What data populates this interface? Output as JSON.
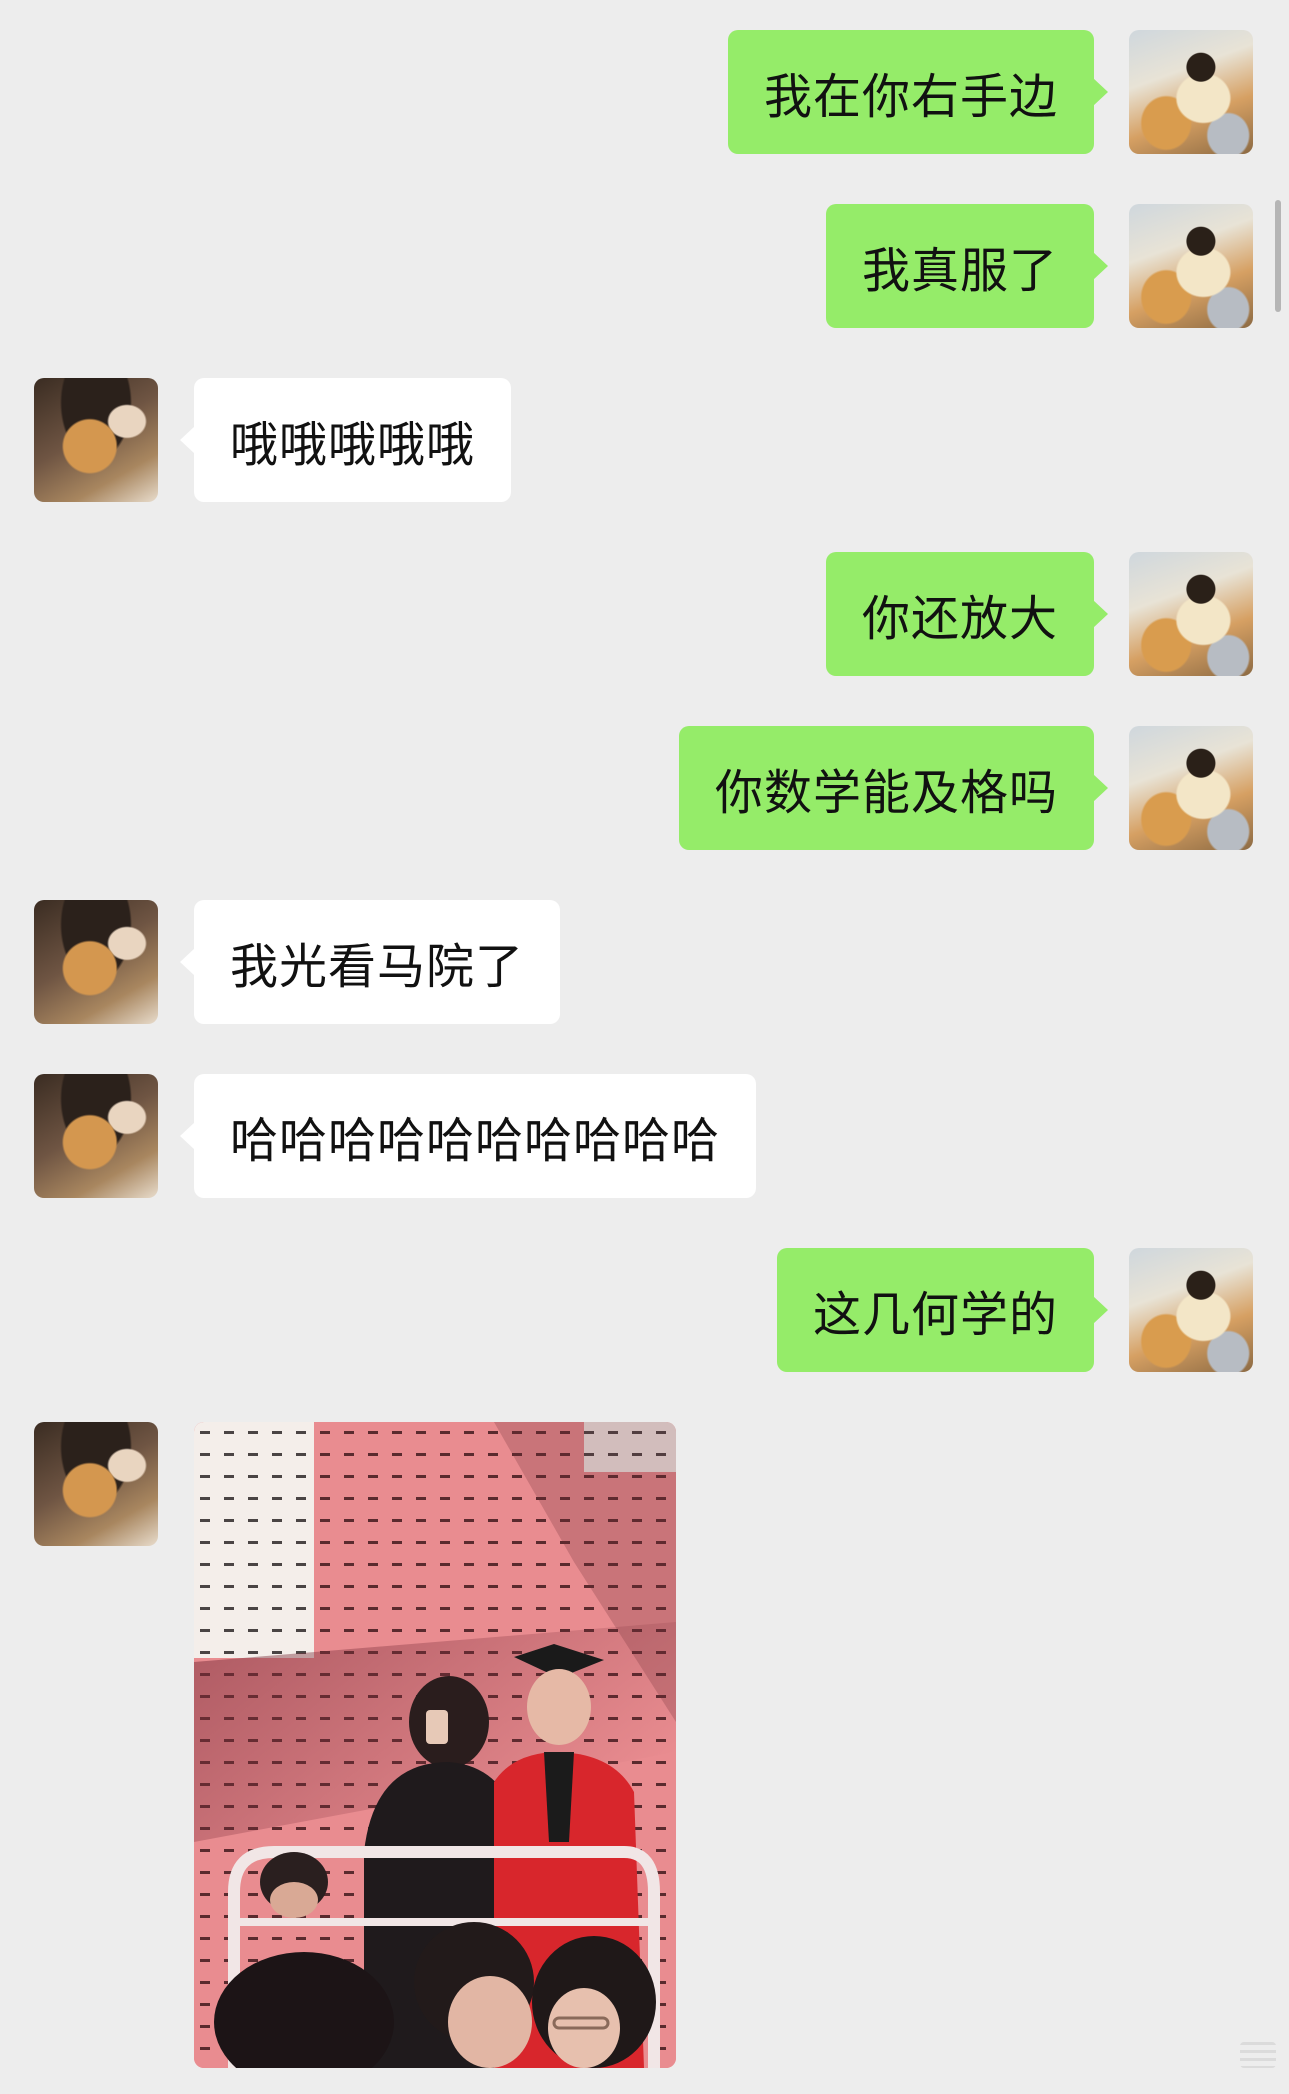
{
  "chat": {
    "messages": [
      {
        "side": "mine",
        "text": "我在你右手边",
        "avatar": "my-avatar"
      },
      {
        "side": "mine",
        "text": "我真服了",
        "avatar": "my-avatar"
      },
      {
        "side": "theirs",
        "text": "哦哦哦哦哦",
        "avatar": "contact-avatar"
      },
      {
        "side": "mine",
        "text": "你还放大",
        "avatar": "my-avatar"
      },
      {
        "side": "mine",
        "text": "你数学能及格吗",
        "avatar": "my-avatar"
      },
      {
        "side": "theirs",
        "text": "我光看马院了",
        "avatar": "contact-avatar"
      },
      {
        "side": "theirs",
        "text": "哈哈哈哈哈哈哈哈哈哈",
        "avatar": "contact-avatar"
      },
      {
        "side": "mine",
        "text": "这几何学的",
        "avatar": "my-avatar"
      }
    ],
    "image_message": {
      "side": "theirs",
      "avatar": "contact-avatar",
      "image": "photo of a graduation ceremony: a woman taking a mirror selfie beside a graduate in cap and red gown, audience in foreground"
    }
  },
  "colors": {
    "background": "#ededed",
    "sent_bubble": "#95ec69",
    "received_bubble": "#ffffff",
    "text": "#111111"
  }
}
